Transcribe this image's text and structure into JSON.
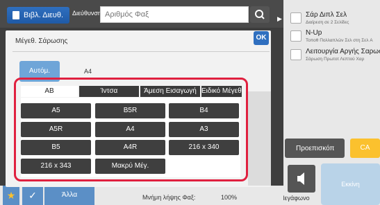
{
  "topbar": {
    "addressbook_label": "Βιβλ. Διευθ.",
    "address_label": "Διεύθυνση",
    "fax_placeholder": "Αριθμός Φαξ"
  },
  "right_panel": {
    "items": [
      {
        "title": "Σάρ Διπλ Σελ",
        "subtitle": "Διαίρεση σε 2 Σελίδες"
      },
      {
        "title": "N-Up",
        "subtitle": "Τοποθ Πολλαπλών Σελ στη Σελ A"
      },
      {
        "title": "Λειτουργία Αργής Σαρωσης",
        "subtitle": "Σάρωση Πρωτοτ Λεπτού Χαρ"
      }
    ],
    "preview_label": "Προεπισκόπ",
    "ca_label": "CA",
    "speaker_label": "Μεγάφωνο",
    "send_label": "Εκκίνη"
  },
  "bottombar": {
    "others_label": "Άλλα",
    "memory_label": "Μνήμη λήψης Φαξ:",
    "memory_value": "100%"
  },
  "dialog": {
    "title": "Μέγεθ. Σάρωσης",
    "ok_label": "OK",
    "auto_label": "Αυτόμ.",
    "auto_size": "A4",
    "tabs": [
      "AB",
      "Ίντσα",
      "Άμεση Εισαγωγή",
      "Ειδικό Μέγεθος"
    ],
    "sizes": [
      "A5",
      "B5R",
      "B4",
      "A5R",
      "A4",
      "A3",
      "B5",
      "A4R",
      "216 x 340",
      "216 x 343",
      "Μακρύ Μέγ."
    ]
  },
  "colors": {
    "highlight": "#e0203f",
    "accent": "#2f6fbf",
    "ca": "#fbc12e"
  }
}
